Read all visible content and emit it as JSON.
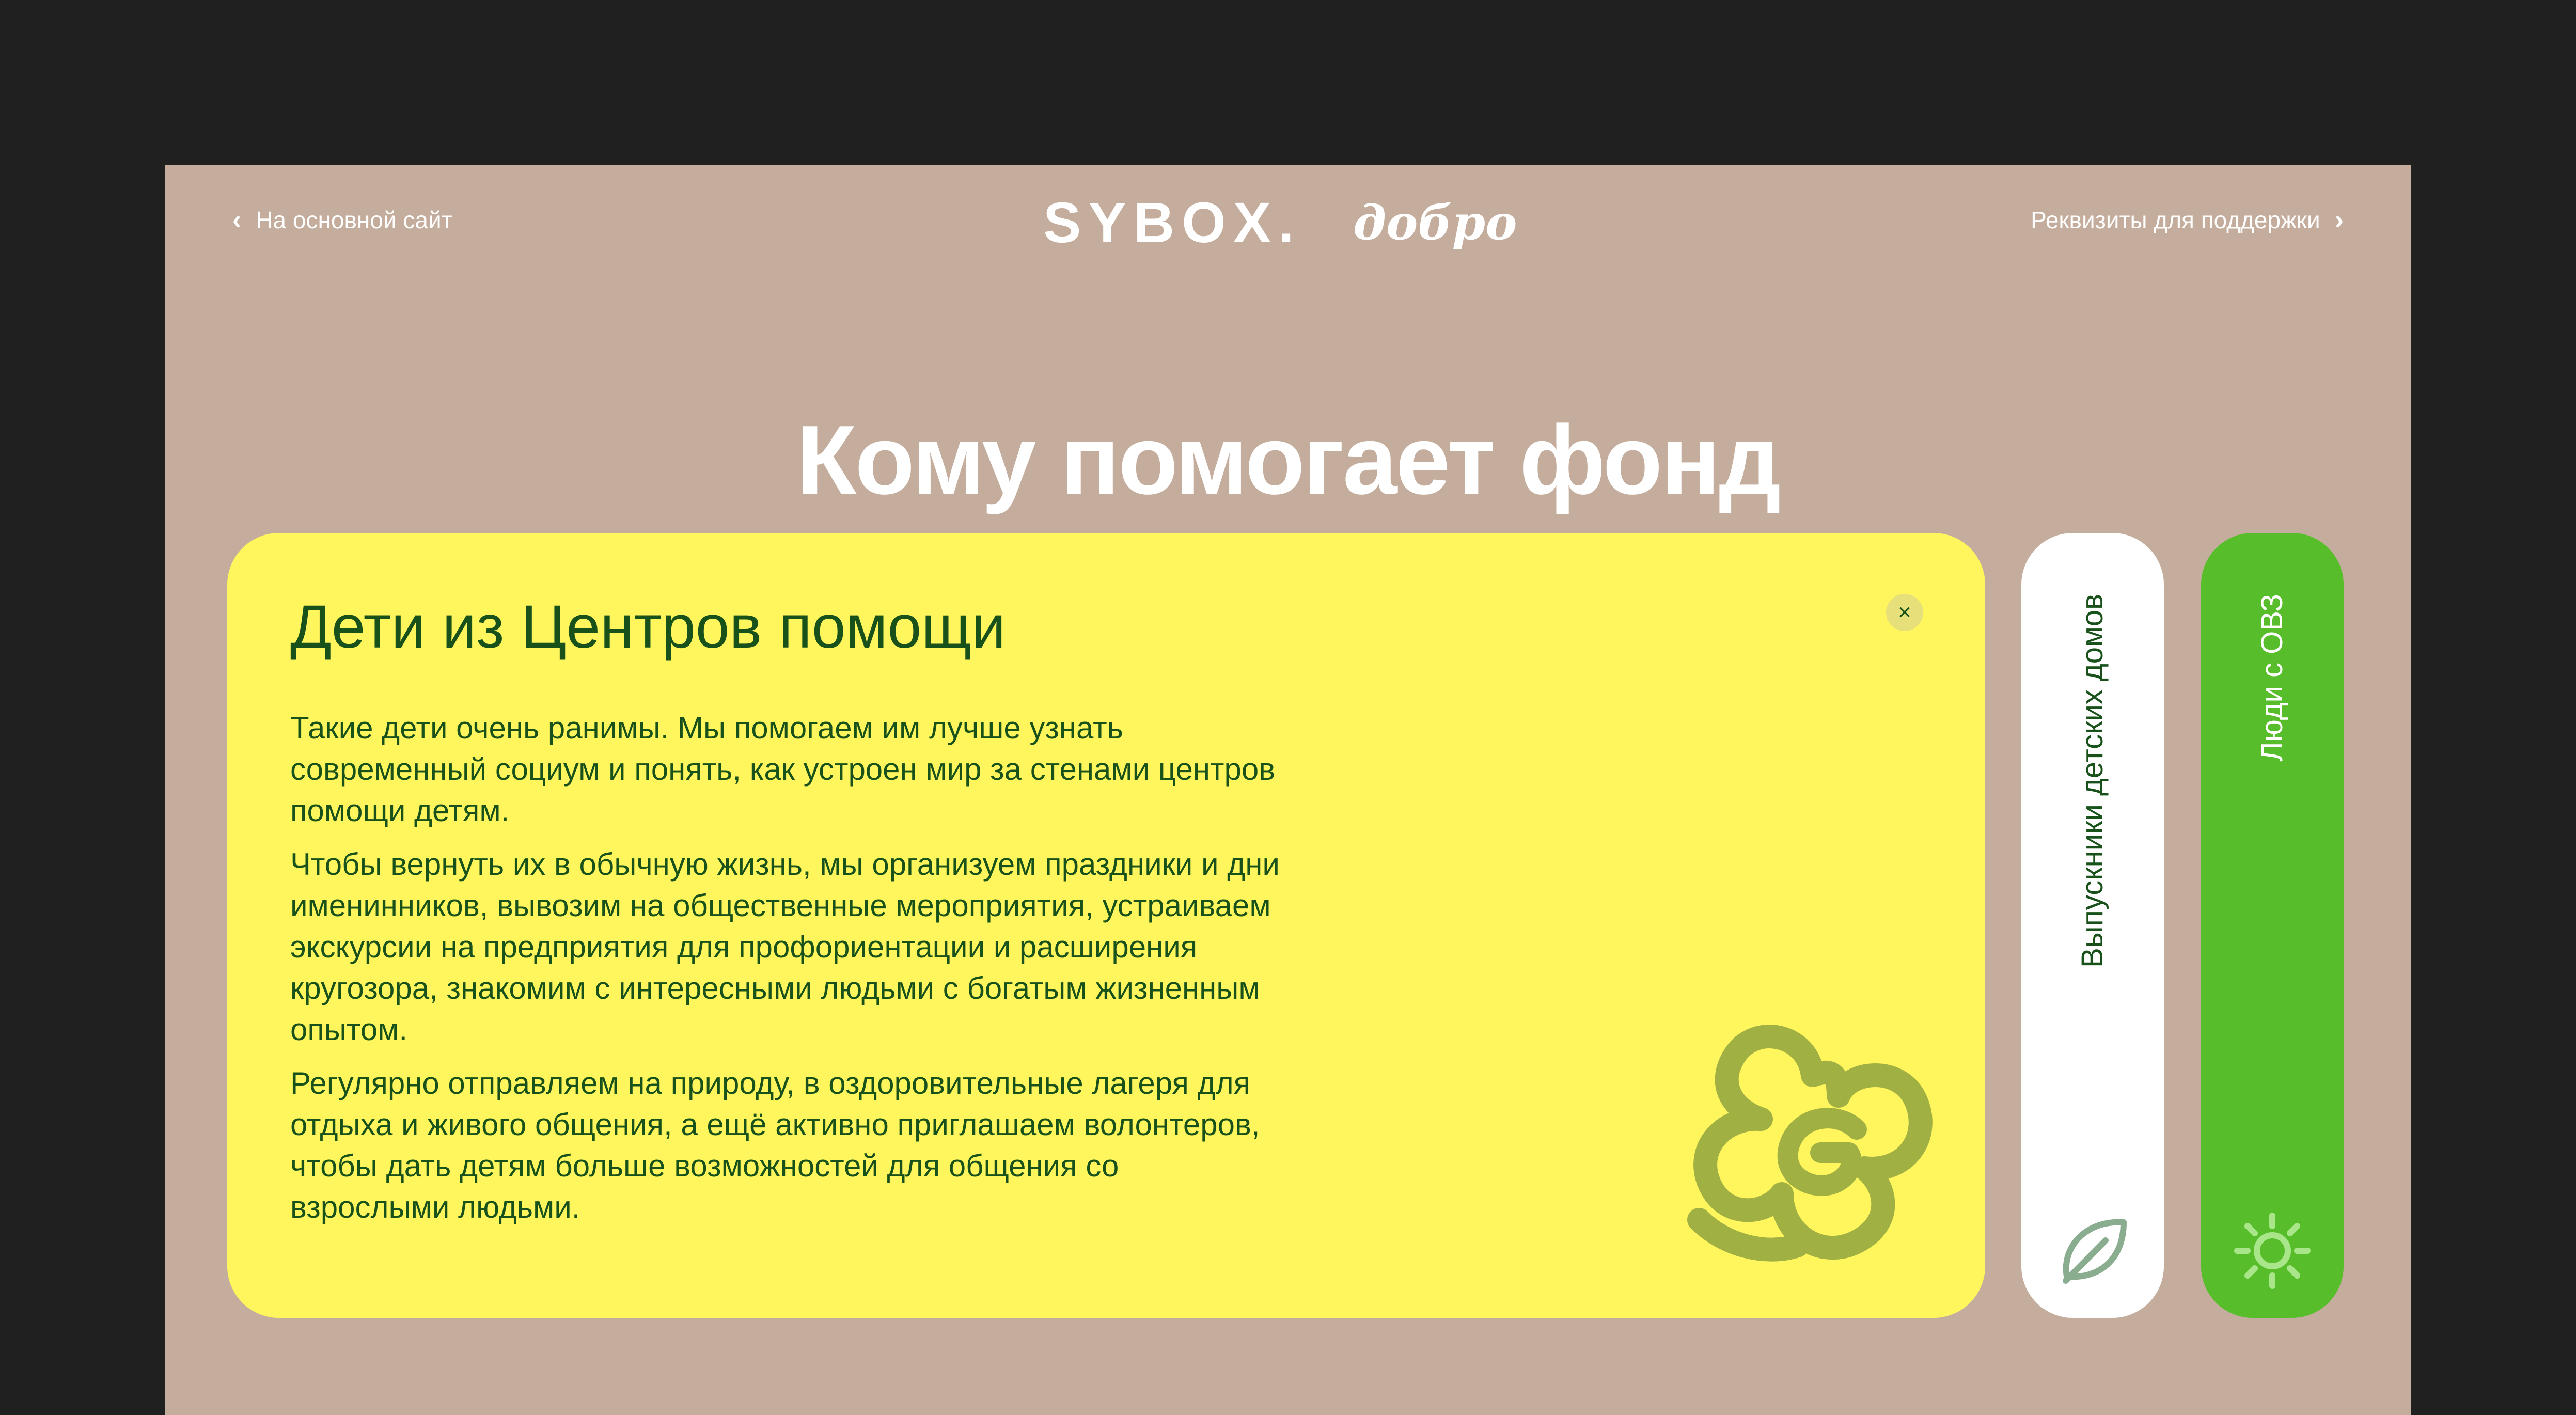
{
  "header": {
    "back_link": "На основной сайт",
    "logo_main": "SYBOX.",
    "logo_script": "добро",
    "support_link": "Реквизиты для поддержки"
  },
  "page_title": "Кому помогает фонд",
  "active_card": {
    "title": "Дети из Центров помощи",
    "paragraphs": [
      "Такие дети очень ранимы. Мы помогаем им лучше узнать современный социум и понять, как устроен мир за стенами центров помощи детям.",
      "Чтобы вернуть их в обычную жизнь, мы организуем праздники и дни именинников, вывозим на общественные мероприятия, устраиваем экскурсии на предприятия для профориентации и расширения кругозора, знакомим с интересными людьми с богатым жизненным опытом.",
      "Регулярно отправляем на природу, в оздоровительные лагеря для отдыха и живого общения, а ещё активно приглашаем волонтеров, чтобы дать детям больше возможностей для общения со взрослыми людьми."
    ],
    "close_label": "×",
    "decoration_icon": "flower-g-icon"
  },
  "tabs": [
    {
      "label": "Выпускники детских домов",
      "icon": "leaf-icon"
    },
    {
      "label": "Люди с ОВЗ",
      "icon": "sun-icon"
    }
  ],
  "colors": {
    "page_bg": "#202020",
    "frame_bg": "#c4ad9c",
    "card_yellow": "#fff55d",
    "text_dark_green": "#18521a",
    "flower_olive": "#a0b043",
    "tab_green": "#57bd2b",
    "leaf_sage": "#8aad90",
    "sun_light_green": "#a9e68a"
  }
}
